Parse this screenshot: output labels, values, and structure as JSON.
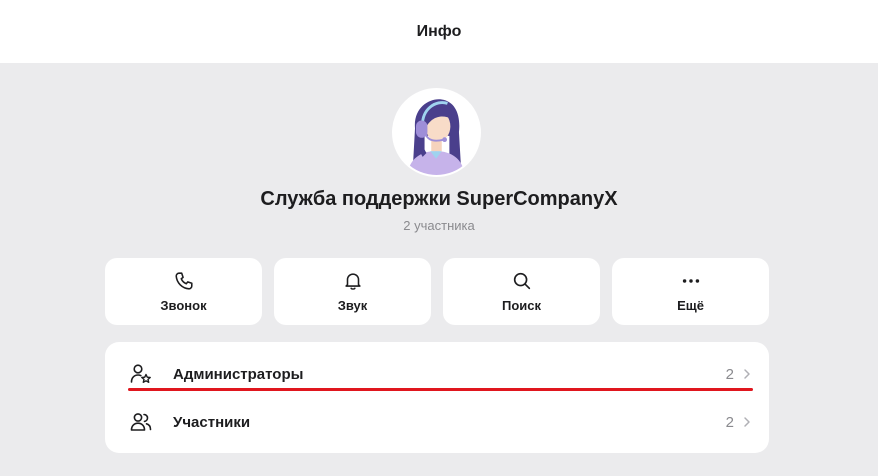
{
  "header": {
    "title": "Инфо"
  },
  "profile": {
    "name": "Служба поддержки SuperCompanyX",
    "subtitle": "2 участника",
    "avatar_icon": "support-agent-avatar"
  },
  "actions": [
    {
      "label": "Звонок",
      "icon": "phone-icon"
    },
    {
      "label": "Звук",
      "icon": "bell-icon"
    },
    {
      "label": "Поиск",
      "icon": "search-icon"
    },
    {
      "label": "Ещё",
      "icon": "more-icon"
    }
  ],
  "list": [
    {
      "label": "Администраторы",
      "count": "2",
      "icon": "admin-user-star-icon"
    },
    {
      "label": "Участники",
      "count": "2",
      "icon": "users-icon"
    }
  ],
  "colors": {
    "background": "#ebebed",
    "card": "#ffffff",
    "text": "#1d1d1f",
    "secondary": "#8a8a8e",
    "annotation_line": "#e0161e"
  }
}
